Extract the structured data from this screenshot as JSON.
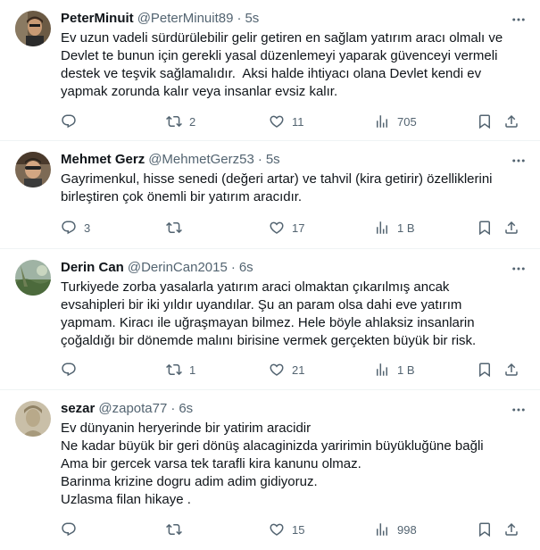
{
  "tweets": [
    {
      "name": "PeterMinuit",
      "handle": "@PeterMinuit89",
      "separator": "·",
      "time": "5s",
      "text": "Ev uzun vadeli sürdürülebilir gelir getiren en sağlam yatırım aracı olmalı ve\nDevlet te bunun için gerekli yasal düzenlemeyi yaparak güvenceyi vermeli\ndestek ve teşvik sağlamalıdır.  Aksi halde ihtiyacı olana Devlet kendi ev\nyapmak zorunda kalır veya insanlar evsiz kalır.",
      "replies": "",
      "retweets": "2",
      "likes": "11",
      "views": "705"
    },
    {
      "name": "Mehmet Gerz",
      "handle": "@MehmetGerz53",
      "separator": "·",
      "time": "5s",
      "text": "Gayrimenkul, hisse senedi (değeri artar) ve tahvil (kira getirir) özelliklerini\nbirleştiren çok önemli bir yatırım aracıdır.",
      "replies": "3",
      "retweets": "",
      "likes": "17",
      "views": "1 B"
    },
    {
      "name": "Derin Can",
      "handle": "@DerinCan2015",
      "separator": "·",
      "time": "6s",
      "text": "Turkiyede zorba yasalarla yatırım araci olmaktan çıkarılmış ancak\nevsahipleri bir iki yıldır uyandılar. Şu an param olsa dahi eve yatırım\nyapmam. Kiracı ile uğraşmayan bilmez. Hele böyle ahlaksiz insanlarin\nçoğaldığı bir dönemde malını birisine vermek gerçekten büyük bir risk.",
      "replies": "",
      "retweets": "1",
      "likes": "21",
      "views": "1 B"
    },
    {
      "name": "sezar",
      "handle": "@zapota77",
      "separator": "·",
      "time": "6s",
      "text": "Ev dünyanin heryerinde bir yatirim aracidir\nNe kadar büyük bir geri dönüş alacaginizda yaririmin büyükluğüne bağli\nAma bir gercek varsa tek tarafli kira kanunu olmaz.\nBarinma krizine dogru adim adim gidiyoruz.\nUzlasma filan hikaye .",
      "replies": "",
      "retweets": "",
      "likes": "15",
      "views": "998"
    }
  ],
  "icons": {
    "reply": "reply-icon",
    "retweet": "retweet-icon",
    "like": "heart-icon",
    "views": "views-icon",
    "bookmark": "bookmark-icon",
    "share": "share-icon",
    "more": "more-icon"
  },
  "colors": {
    "text": "#0f1419",
    "secondary": "#536471",
    "divider": "#eff3f4"
  }
}
